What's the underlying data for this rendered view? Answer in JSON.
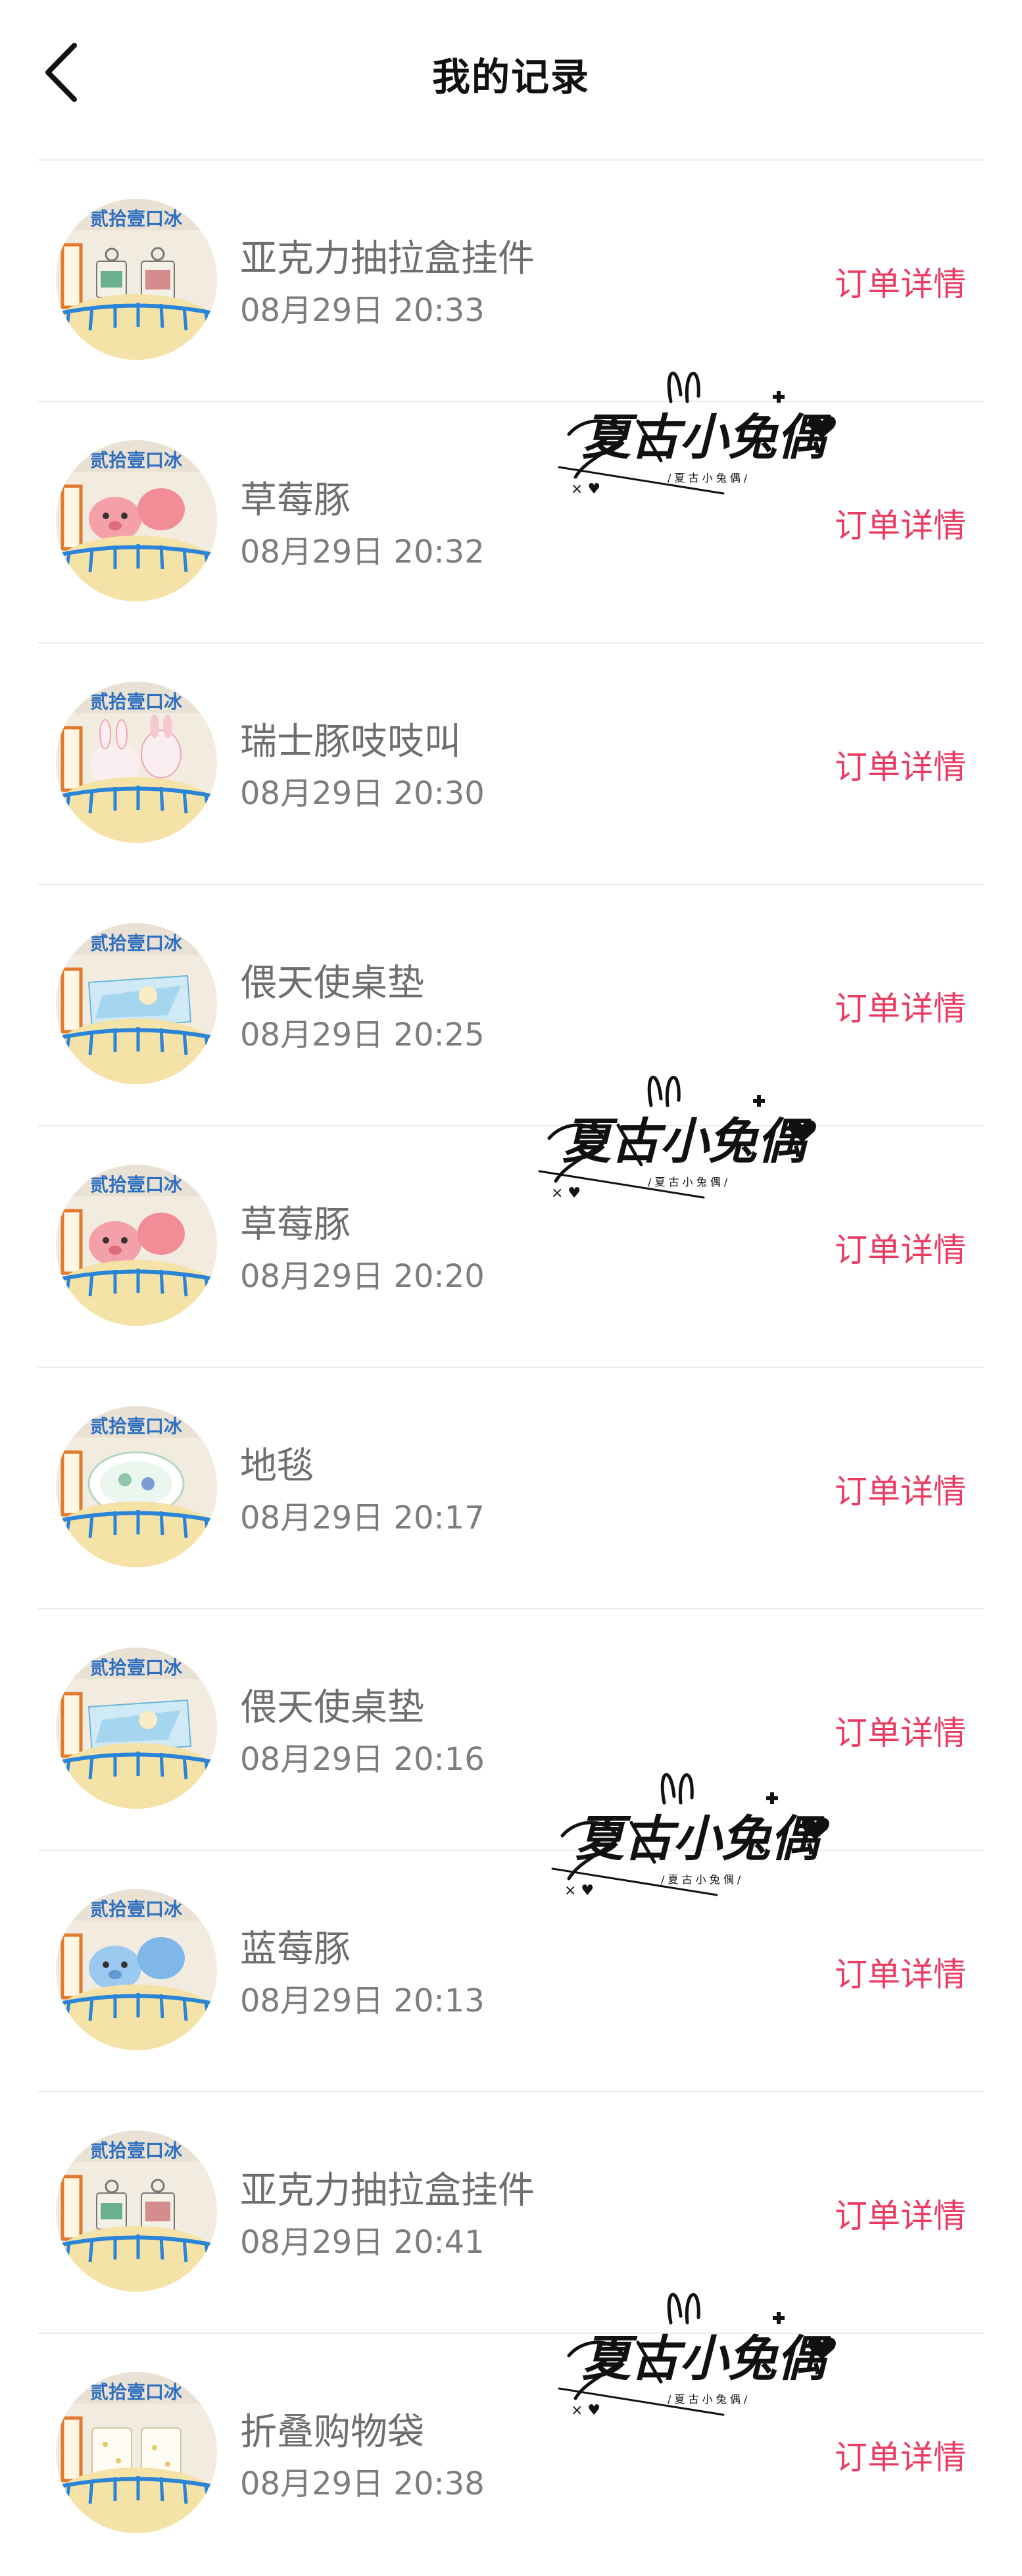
{
  "header": {
    "title": "我的记录",
    "back_icon": "chevron-left-icon"
  },
  "accent_color": "#ea3c63",
  "watermark_text": "夏古小兔偶",
  "items": [
    {
      "title": "亚克力抽拉盒挂件",
      "time": "08月29日 20:33",
      "action": "订单详情",
      "thumb": "acrylic-box"
    },
    {
      "title": "草莓豚",
      "time": "08月29日 20:32",
      "action": "订单详情",
      "thumb": "pink-pig"
    },
    {
      "title": "瑞士豚吱吱叫",
      "time": "08月29日 20:30",
      "action": "订单详情",
      "thumb": "white-bunny"
    },
    {
      "title": "偎天使桌垫",
      "time": "08月29日 20:25",
      "action": "订单详情",
      "thumb": "desk-mat"
    },
    {
      "title": "草莓豚",
      "time": "08月29日 20:20",
      "action": "订单详情",
      "thumb": "pink-pig"
    },
    {
      "title": "地毯",
      "time": "08月29日 20:17",
      "action": "订单详情",
      "thumb": "rug"
    },
    {
      "title": "偎天使桌垫",
      "time": "08月29日 20:16",
      "action": "订单详情",
      "thumb": "desk-mat"
    },
    {
      "title": "蓝莓豚",
      "time": "08月29日 20:13",
      "action": "订单详情",
      "thumb": "blue-pig"
    },
    {
      "title": "亚克力抽拉盒挂件",
      "time": "08月29日 20:41",
      "action": "订单详情",
      "thumb": "acrylic-box"
    },
    {
      "title": "折叠购物袋",
      "time": "08月29日 20:38",
      "action": "订单详情",
      "thumb": "tote-bag"
    }
  ]
}
